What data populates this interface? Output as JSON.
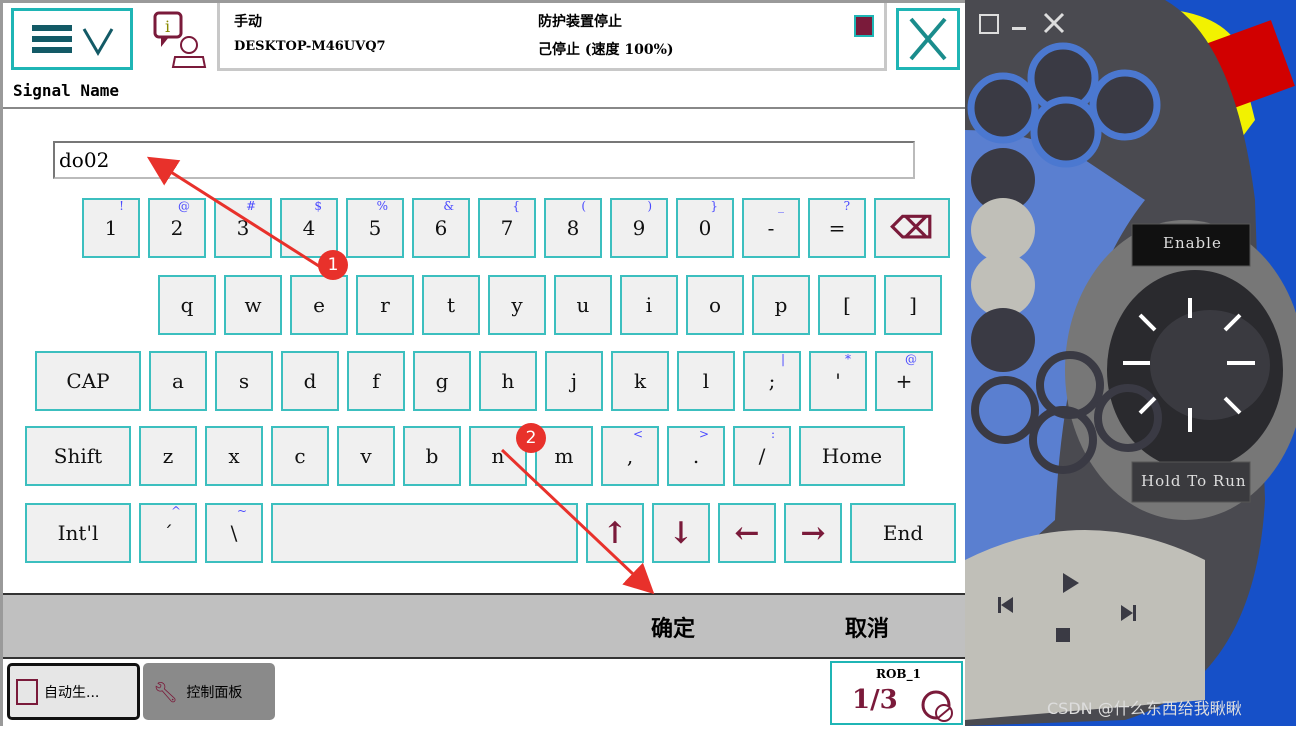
{
  "header": {
    "mode": "手动",
    "system": "DESKTOP-M46UVQ7",
    "status": "防护装置停止",
    "state": "己停止 (速度 100%)"
  },
  "page": {
    "title": "Signal Name"
  },
  "input": {
    "value": "do02"
  },
  "keyboard": {
    "rows": [
      [
        {
          "l": "1",
          "s": "!"
        },
        {
          "l": "2",
          "s": "@"
        },
        {
          "l": "3",
          "s": "#"
        },
        {
          "l": "4",
          "s": "$"
        },
        {
          "l": "5",
          "s": "%"
        },
        {
          "l": "6",
          "s": "&"
        },
        {
          "l": "7",
          "s": "{"
        },
        {
          "l": "8",
          "s": "("
        },
        {
          "l": "9",
          "s": ")"
        },
        {
          "l": "0",
          "s": "}"
        },
        {
          "l": "-",
          "s": "_"
        },
        {
          "l": "=",
          "s": "?"
        },
        {
          "l": "⌫",
          "s": "",
          "icon": "backspace-icon"
        }
      ],
      [
        {
          "l": "q",
          "s": ""
        },
        {
          "l": "w",
          "s": ""
        },
        {
          "l": "e",
          "s": ""
        },
        {
          "l": "r",
          "s": ""
        },
        {
          "l": "t",
          "s": ""
        },
        {
          "l": "y",
          "s": ""
        },
        {
          "l": "u",
          "s": ""
        },
        {
          "l": "i",
          "s": ""
        },
        {
          "l": "o",
          "s": ""
        },
        {
          "l": "p",
          "s": ""
        },
        {
          "l": "[",
          "s": ""
        },
        {
          "l": "]",
          "s": ""
        }
      ],
      [
        {
          "l": "CAP",
          "s": ""
        },
        {
          "l": "a",
          "s": ""
        },
        {
          "l": "s",
          "s": ""
        },
        {
          "l": "d",
          "s": ""
        },
        {
          "l": "f",
          "s": ""
        },
        {
          "l": "g",
          "s": ""
        },
        {
          "l": "h",
          "s": ""
        },
        {
          "l": "j",
          "s": ""
        },
        {
          "l": "k",
          "s": ""
        },
        {
          "l": "l",
          "s": ""
        },
        {
          "l": ";",
          "s": "|"
        },
        {
          "l": "'",
          "s": "*"
        },
        {
          "l": "+",
          "s": "@"
        }
      ],
      [
        {
          "l": "Shift",
          "s": ""
        },
        {
          "l": "z",
          "s": ""
        },
        {
          "l": "x",
          "s": ""
        },
        {
          "l": "c",
          "s": ""
        },
        {
          "l": "v",
          "s": ""
        },
        {
          "l": "b",
          "s": ""
        },
        {
          "l": "n",
          "s": ""
        },
        {
          "l": "m",
          "s": ""
        },
        {
          "l": ",",
          "s": "<"
        },
        {
          "l": ".",
          "s": ">"
        },
        {
          "l": "/",
          "s": ":"
        },
        {
          "l": "Home",
          "s": ""
        }
      ],
      [
        {
          "l": "Int'l",
          "s": ""
        },
        {
          "l": "´",
          "s": "^"
        },
        {
          "l": "\\",
          "s": "~"
        },
        {
          "l": "",
          "s": "",
          "icon": "space"
        },
        {
          "l": "↑",
          "s": "",
          "icon": "arrow-up-icon"
        },
        {
          "l": "↓",
          "s": "",
          "icon": "arrow-down-icon"
        },
        {
          "l": "←",
          "s": "",
          "icon": "arrow-left-icon"
        },
        {
          "l": "→",
          "s": "",
          "icon": "arrow-right-icon"
        },
        {
          "l": "End",
          "s": ""
        }
      ]
    ]
  },
  "actions": {
    "ok": "确定",
    "cancel": "取消"
  },
  "taskbar": {
    "app1": "自动生...",
    "app2": "控制面板",
    "robot": "ROB_1",
    "fraction": "1/3"
  },
  "annotations": {
    "m1": "1",
    "m2": "2",
    "color": "#e8312b"
  },
  "pendant": {
    "enable": "Enable",
    "hold": "Hold To Run"
  },
  "watermark": "CSDN @什么东西给我瞅瞅",
  "colors": {
    "teal": "#1fb5b5",
    "maroon": "#7a1a3a",
    "keyBorder": "#3cbfbf",
    "pendantBlue": "#1650c8"
  }
}
